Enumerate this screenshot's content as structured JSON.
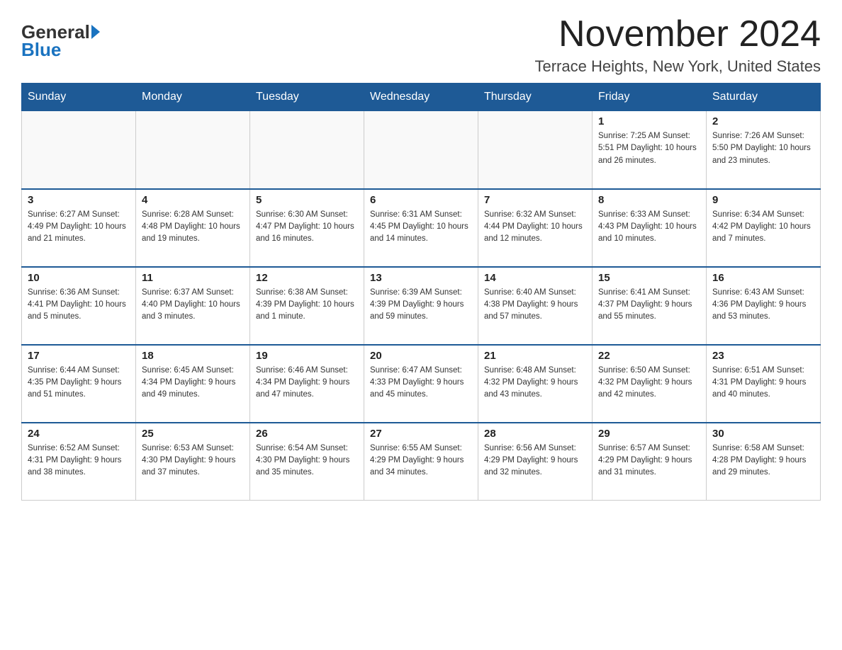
{
  "header": {
    "logo_general": "General",
    "logo_blue": "Blue",
    "month_title": "November 2024",
    "location": "Terrace Heights, New York, United States"
  },
  "weekdays": [
    "Sunday",
    "Monday",
    "Tuesday",
    "Wednesday",
    "Thursday",
    "Friday",
    "Saturday"
  ],
  "weeks": [
    [
      {
        "day": "",
        "info": ""
      },
      {
        "day": "",
        "info": ""
      },
      {
        "day": "",
        "info": ""
      },
      {
        "day": "",
        "info": ""
      },
      {
        "day": "",
        "info": ""
      },
      {
        "day": "1",
        "info": "Sunrise: 7:25 AM\nSunset: 5:51 PM\nDaylight: 10 hours and 26 minutes."
      },
      {
        "day": "2",
        "info": "Sunrise: 7:26 AM\nSunset: 5:50 PM\nDaylight: 10 hours and 23 minutes."
      }
    ],
    [
      {
        "day": "3",
        "info": "Sunrise: 6:27 AM\nSunset: 4:49 PM\nDaylight: 10 hours and 21 minutes."
      },
      {
        "day": "4",
        "info": "Sunrise: 6:28 AM\nSunset: 4:48 PM\nDaylight: 10 hours and 19 minutes."
      },
      {
        "day": "5",
        "info": "Sunrise: 6:30 AM\nSunset: 4:47 PM\nDaylight: 10 hours and 16 minutes."
      },
      {
        "day": "6",
        "info": "Sunrise: 6:31 AM\nSunset: 4:45 PM\nDaylight: 10 hours and 14 minutes."
      },
      {
        "day": "7",
        "info": "Sunrise: 6:32 AM\nSunset: 4:44 PM\nDaylight: 10 hours and 12 minutes."
      },
      {
        "day": "8",
        "info": "Sunrise: 6:33 AM\nSunset: 4:43 PM\nDaylight: 10 hours and 10 minutes."
      },
      {
        "day": "9",
        "info": "Sunrise: 6:34 AM\nSunset: 4:42 PM\nDaylight: 10 hours and 7 minutes."
      }
    ],
    [
      {
        "day": "10",
        "info": "Sunrise: 6:36 AM\nSunset: 4:41 PM\nDaylight: 10 hours and 5 minutes."
      },
      {
        "day": "11",
        "info": "Sunrise: 6:37 AM\nSunset: 4:40 PM\nDaylight: 10 hours and 3 minutes."
      },
      {
        "day": "12",
        "info": "Sunrise: 6:38 AM\nSunset: 4:39 PM\nDaylight: 10 hours and 1 minute."
      },
      {
        "day": "13",
        "info": "Sunrise: 6:39 AM\nSunset: 4:39 PM\nDaylight: 9 hours and 59 minutes."
      },
      {
        "day": "14",
        "info": "Sunrise: 6:40 AM\nSunset: 4:38 PM\nDaylight: 9 hours and 57 minutes."
      },
      {
        "day": "15",
        "info": "Sunrise: 6:41 AM\nSunset: 4:37 PM\nDaylight: 9 hours and 55 minutes."
      },
      {
        "day": "16",
        "info": "Sunrise: 6:43 AM\nSunset: 4:36 PM\nDaylight: 9 hours and 53 minutes."
      }
    ],
    [
      {
        "day": "17",
        "info": "Sunrise: 6:44 AM\nSunset: 4:35 PM\nDaylight: 9 hours and 51 minutes."
      },
      {
        "day": "18",
        "info": "Sunrise: 6:45 AM\nSunset: 4:34 PM\nDaylight: 9 hours and 49 minutes."
      },
      {
        "day": "19",
        "info": "Sunrise: 6:46 AM\nSunset: 4:34 PM\nDaylight: 9 hours and 47 minutes."
      },
      {
        "day": "20",
        "info": "Sunrise: 6:47 AM\nSunset: 4:33 PM\nDaylight: 9 hours and 45 minutes."
      },
      {
        "day": "21",
        "info": "Sunrise: 6:48 AM\nSunset: 4:32 PM\nDaylight: 9 hours and 43 minutes."
      },
      {
        "day": "22",
        "info": "Sunrise: 6:50 AM\nSunset: 4:32 PM\nDaylight: 9 hours and 42 minutes."
      },
      {
        "day": "23",
        "info": "Sunrise: 6:51 AM\nSunset: 4:31 PM\nDaylight: 9 hours and 40 minutes."
      }
    ],
    [
      {
        "day": "24",
        "info": "Sunrise: 6:52 AM\nSunset: 4:31 PM\nDaylight: 9 hours and 38 minutes."
      },
      {
        "day": "25",
        "info": "Sunrise: 6:53 AM\nSunset: 4:30 PM\nDaylight: 9 hours and 37 minutes."
      },
      {
        "day": "26",
        "info": "Sunrise: 6:54 AM\nSunset: 4:30 PM\nDaylight: 9 hours and 35 minutes."
      },
      {
        "day": "27",
        "info": "Sunrise: 6:55 AM\nSunset: 4:29 PM\nDaylight: 9 hours and 34 minutes."
      },
      {
        "day": "28",
        "info": "Sunrise: 6:56 AM\nSunset: 4:29 PM\nDaylight: 9 hours and 32 minutes."
      },
      {
        "day": "29",
        "info": "Sunrise: 6:57 AM\nSunset: 4:29 PM\nDaylight: 9 hours and 31 minutes."
      },
      {
        "day": "30",
        "info": "Sunrise: 6:58 AM\nSunset: 4:28 PM\nDaylight: 9 hours and 29 minutes."
      }
    ]
  ]
}
